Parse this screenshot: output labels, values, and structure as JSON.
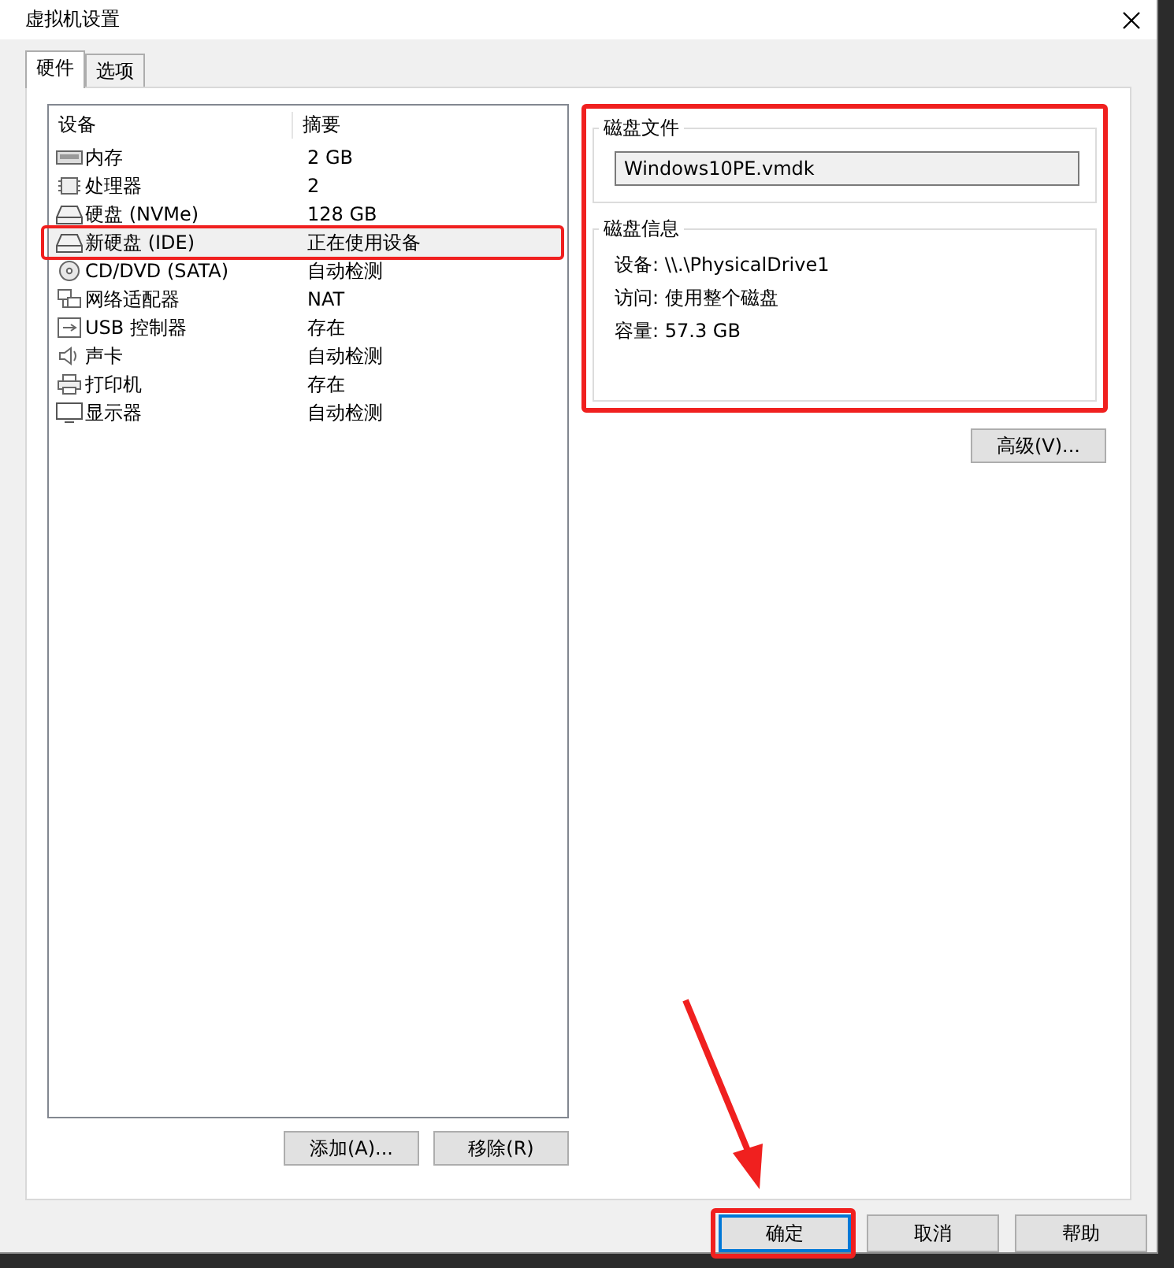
{
  "window": {
    "title": "虚拟机设置"
  },
  "tabs": [
    {
      "label": "硬件",
      "selected": true
    },
    {
      "label": "选项",
      "selected": false
    }
  ],
  "device_list": {
    "columns": [
      "设备",
      "摘要"
    ],
    "rows": [
      {
        "kind": "memory",
        "name": "内存",
        "summary": "2 GB",
        "selected": false,
        "highlighted": false
      },
      {
        "kind": "cpu",
        "name": "处理器",
        "summary": "2",
        "selected": false,
        "highlighted": false
      },
      {
        "kind": "disk",
        "name": "硬盘 (NVMe)",
        "summary": "128 GB",
        "selected": false,
        "highlighted": false
      },
      {
        "kind": "disk",
        "name": "新硬盘 (IDE)",
        "summary": "正在使用设备",
        "selected": true,
        "highlighted": true
      },
      {
        "kind": "cd",
        "name": "CD/DVD (SATA)",
        "summary": "自动检测",
        "selected": false,
        "highlighted": false
      },
      {
        "kind": "network",
        "name": "网络适配器",
        "summary": "NAT",
        "selected": false,
        "highlighted": false
      },
      {
        "kind": "usb",
        "name": "USB 控制器",
        "summary": "存在",
        "selected": false,
        "highlighted": false
      },
      {
        "kind": "sound",
        "name": "声卡",
        "summary": "自动检测",
        "selected": false,
        "highlighted": false
      },
      {
        "kind": "printer",
        "name": "打印机",
        "summary": "存在",
        "selected": false,
        "highlighted": false
      },
      {
        "kind": "display",
        "name": "显示器",
        "summary": "自动检测",
        "selected": false,
        "highlighted": false
      }
    ]
  },
  "list_buttons": [
    "添加(A)...",
    "移除(R)"
  ],
  "disk_panel": {
    "highlighted": true,
    "disk_file": {
      "title": "磁盘文件",
      "value": "Windows10PE.vmdk"
    },
    "disk_info": {
      "title": "磁盘信息",
      "lines": [
        {
          "label": "设备:",
          "value": "\\\\.\\PhysicalDrive1"
        },
        {
          "label": "访问:",
          "value": "使用整个磁盘"
        },
        {
          "label": "容量:",
          "value": "57.3 GB"
        }
      ]
    }
  },
  "advanced_button": "高级(V)...",
  "dialog_buttons": [
    {
      "label": "确定",
      "focused": true,
      "highlighted": true
    },
    {
      "label": "取消",
      "focused": false,
      "highlighted": false
    },
    {
      "label": "帮助",
      "focused": false,
      "highlighted": false
    }
  ]
}
